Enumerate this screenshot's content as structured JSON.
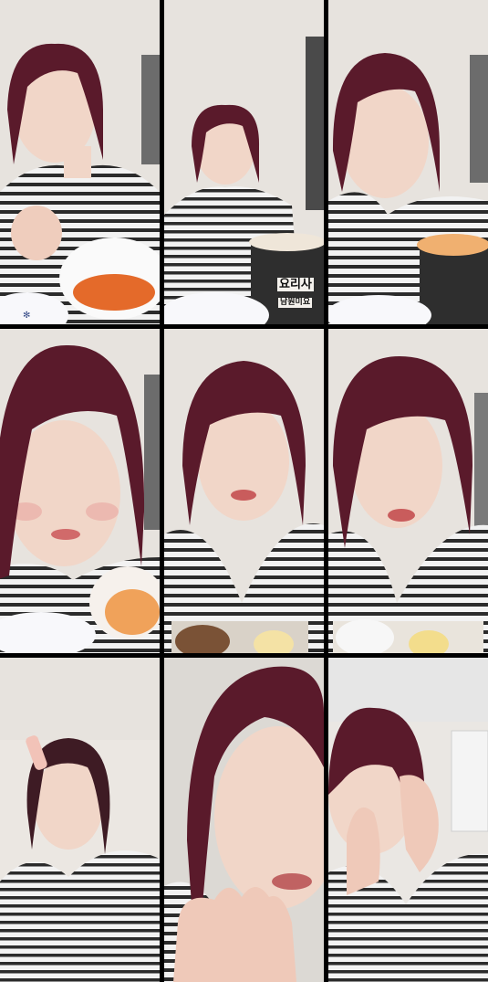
{
  "collage": {
    "layout": "3x3 grid",
    "tiles": [
      {
        "id": "tile-1",
        "subject": "woman-striped-shirt-eating",
        "props": [
          "bowl-of-noodles",
          "patterned-plate"
        ]
      },
      {
        "id": "tile-2",
        "subject": "woman-striped-shirt-distant",
        "props": [
          "noodle-cup",
          "patterned-plate"
        ],
        "package_text": [
          "요리사",
          "남원미요"
        ]
      },
      {
        "id": "tile-3",
        "subject": "woman-striped-shirt-closeup",
        "props": [
          "noodle-cup",
          "patterned-plate"
        ]
      },
      {
        "id": "tile-4",
        "subject": "woman-closeup-left",
        "props": [
          "noodle-bowl",
          "patterned-plate"
        ]
      },
      {
        "id": "tile-5",
        "subject": "woman-closeup-center",
        "props": [
          "pastry-tray"
        ]
      },
      {
        "id": "tile-6",
        "subject": "woman-closeup-right",
        "props": [
          "pastry-tray"
        ]
      },
      {
        "id": "tile-7",
        "subject": "woman-hair-clip",
        "props": []
      },
      {
        "id": "tile-8",
        "subject": "woman-hand-to-face",
        "props": []
      },
      {
        "id": "tile-9",
        "subject": "woman-hands-on-cheeks",
        "props": []
      }
    ]
  },
  "colors": {
    "separator": "#000000",
    "wall": "#e7e3de",
    "hair": "#5a1a2b",
    "skin": "#f1d6c8",
    "stripe_dark": "#2b2b2b",
    "stripe_light": "#f2f2f2"
  }
}
